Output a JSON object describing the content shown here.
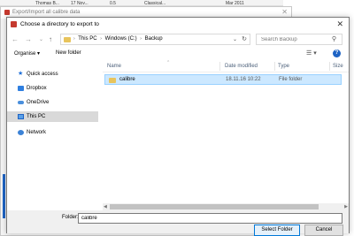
{
  "background": {
    "table_row": [
      "Thomas B...",
      "17 Nov...",
      "0.5",
      "Classical...",
      "Mar 2011"
    ],
    "dialog_title": "Export/Import all calibre data",
    "close_glyph": "✕"
  },
  "dialog": {
    "title": "Choose a directory to export to",
    "close_glyph": "✕"
  },
  "address": {
    "crumbs": [
      "This PC",
      "Windows (C:)",
      "Backup"
    ],
    "separator": "›",
    "search_placeholder": "Search Backup"
  },
  "toolbar": {
    "organise_label": "Organise ▾",
    "new_folder_label": "New folder",
    "help_label": "?"
  },
  "nav_pane": {
    "items": [
      {
        "label": "Quick access",
        "icon": "star-icon"
      },
      {
        "label": "Dropbox",
        "icon": "dropbox-icon"
      },
      {
        "label": "OneDrive",
        "icon": "cloud-icon"
      },
      {
        "label": "This PC",
        "icon": "computer-icon",
        "selected": true
      },
      {
        "label": "Network",
        "icon": "network-icon"
      }
    ]
  },
  "file_list": {
    "columns": [
      "Name",
      "Date modified",
      "Type",
      "Size"
    ],
    "rows": [
      {
        "name": "calibre",
        "date": "18.11.16 10:22",
        "type": "File folder"
      }
    ]
  },
  "footer": {
    "folder_label": "Folder:",
    "folder_value": "calibre",
    "select_label": "Select Folder",
    "cancel_label": "Cancel"
  },
  "colors": {
    "accent": "#0078d7",
    "selection": "#cce8ff",
    "folder": "#e8c45c",
    "app_icon": "#c53a2f"
  }
}
